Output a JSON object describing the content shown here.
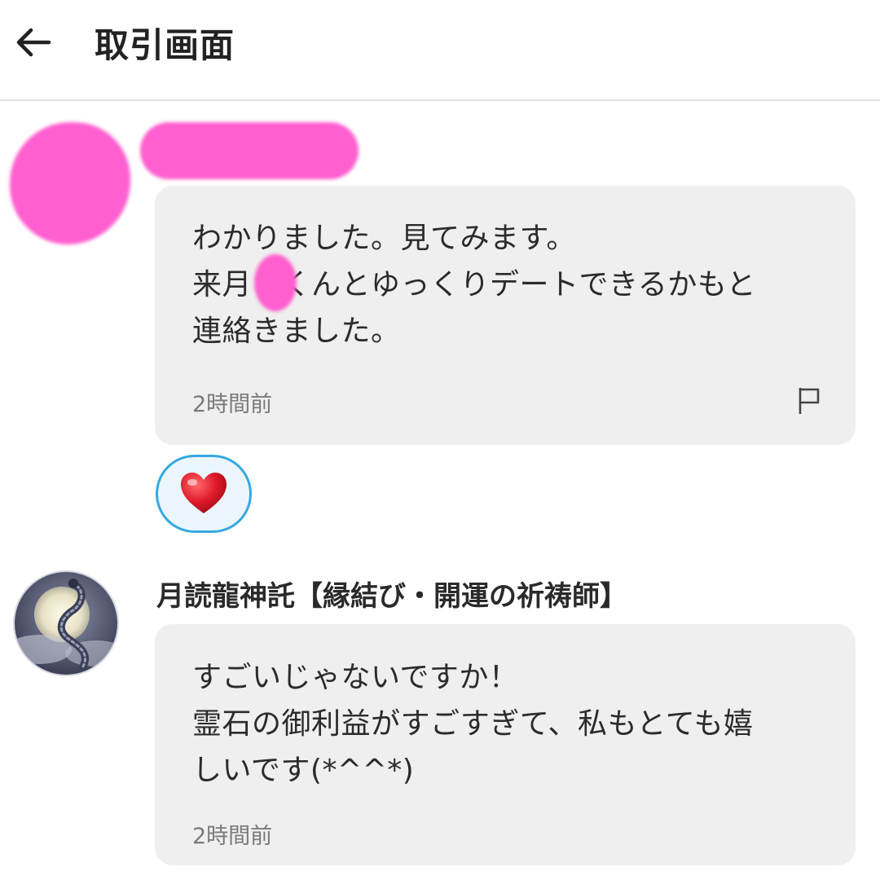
{
  "header": {
    "title": "取引画面",
    "back_icon": "arrow-left-icon"
  },
  "messages": [
    {
      "sender": "",
      "sender_redacted": true,
      "lines": [
        "わかりました。見てみます。",
        "来月　くんとゆっくりデートできるかもと",
        "連絡きました。"
      ],
      "time": "2時間前",
      "flag_icon": "flag-icon",
      "reaction_icon": "heart-icon"
    },
    {
      "sender": "月読龍神託【縁結び・開運の祈祷師】",
      "avatar_icon": "dragon-moon-avatar",
      "lines": [
        "すごいじゃないですか！",
        "霊石の御利益がすごすぎて、私もとても嬉",
        "しいです(*^^*)"
      ],
      "time": "2時間前"
    }
  ],
  "colors": {
    "bubble": "#efefef",
    "redaction": "#ff5fcf",
    "reaction_border": "#35a8e0",
    "heart": "#e0192b"
  }
}
